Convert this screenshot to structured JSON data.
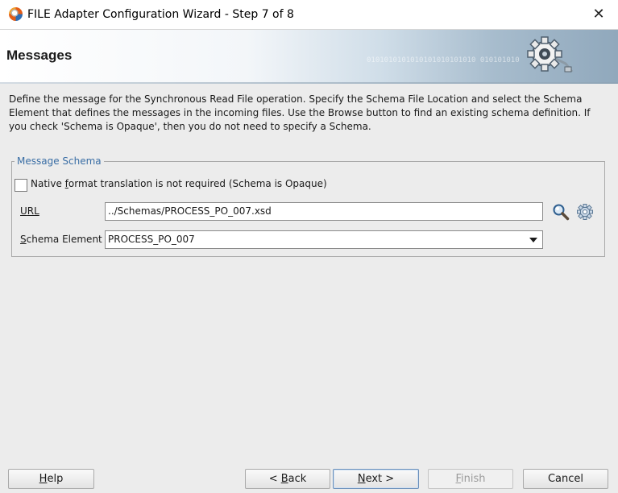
{
  "window": {
    "title": "FILE Adapter Configuration Wizard - Step 7 of 8",
    "close_glyph": "✕"
  },
  "banner": {
    "title": "Messages",
    "decoration_text": "0101010101010101010101010 0101010101010"
  },
  "description": {
    "line1": "Define the message for the Synchronous Read File operation.  Specify the Schema File Location and select the Schema",
    "line2": "Element that defines the messages in the incoming files. Use the Browse button to find an existing schema definition. If",
    "line3": "you check 'Schema is Opaque', then you do not need to specify a Schema."
  },
  "message_schema": {
    "legend": "Message Schema",
    "opaque_checkbox": {
      "label_pre": "Native ",
      "label_mnemonic": "f",
      "label_post": "ormat translation is not required (Schema is Opaque)",
      "checked": false
    },
    "url": {
      "label_mnemonic": "U",
      "label_post": "RL",
      "value": "../Schemas/PROCESS_PO_007.xsd",
      "browse_icon": "search-icon",
      "settings_icon": "gear-icon"
    },
    "schema_element": {
      "label_mnemonic": "S",
      "label_post": "chema Element",
      "selected": "PROCESS_PO_007"
    }
  },
  "buttons": {
    "help": {
      "mnemonic": "H",
      "rest": "elp"
    },
    "back": {
      "prefix": "< ",
      "mnemonic": "B",
      "rest": "ack"
    },
    "next": {
      "mnemonic": "N",
      "rest": "ext >"
    },
    "finish": {
      "mnemonic": "F",
      "rest": "inish"
    },
    "cancel": {
      "label": "Cancel"
    }
  },
  "colors": {
    "legend_text": "#3a6ea5",
    "banner_gradient_end": "#90a8bc",
    "window_background": "#ececec"
  }
}
